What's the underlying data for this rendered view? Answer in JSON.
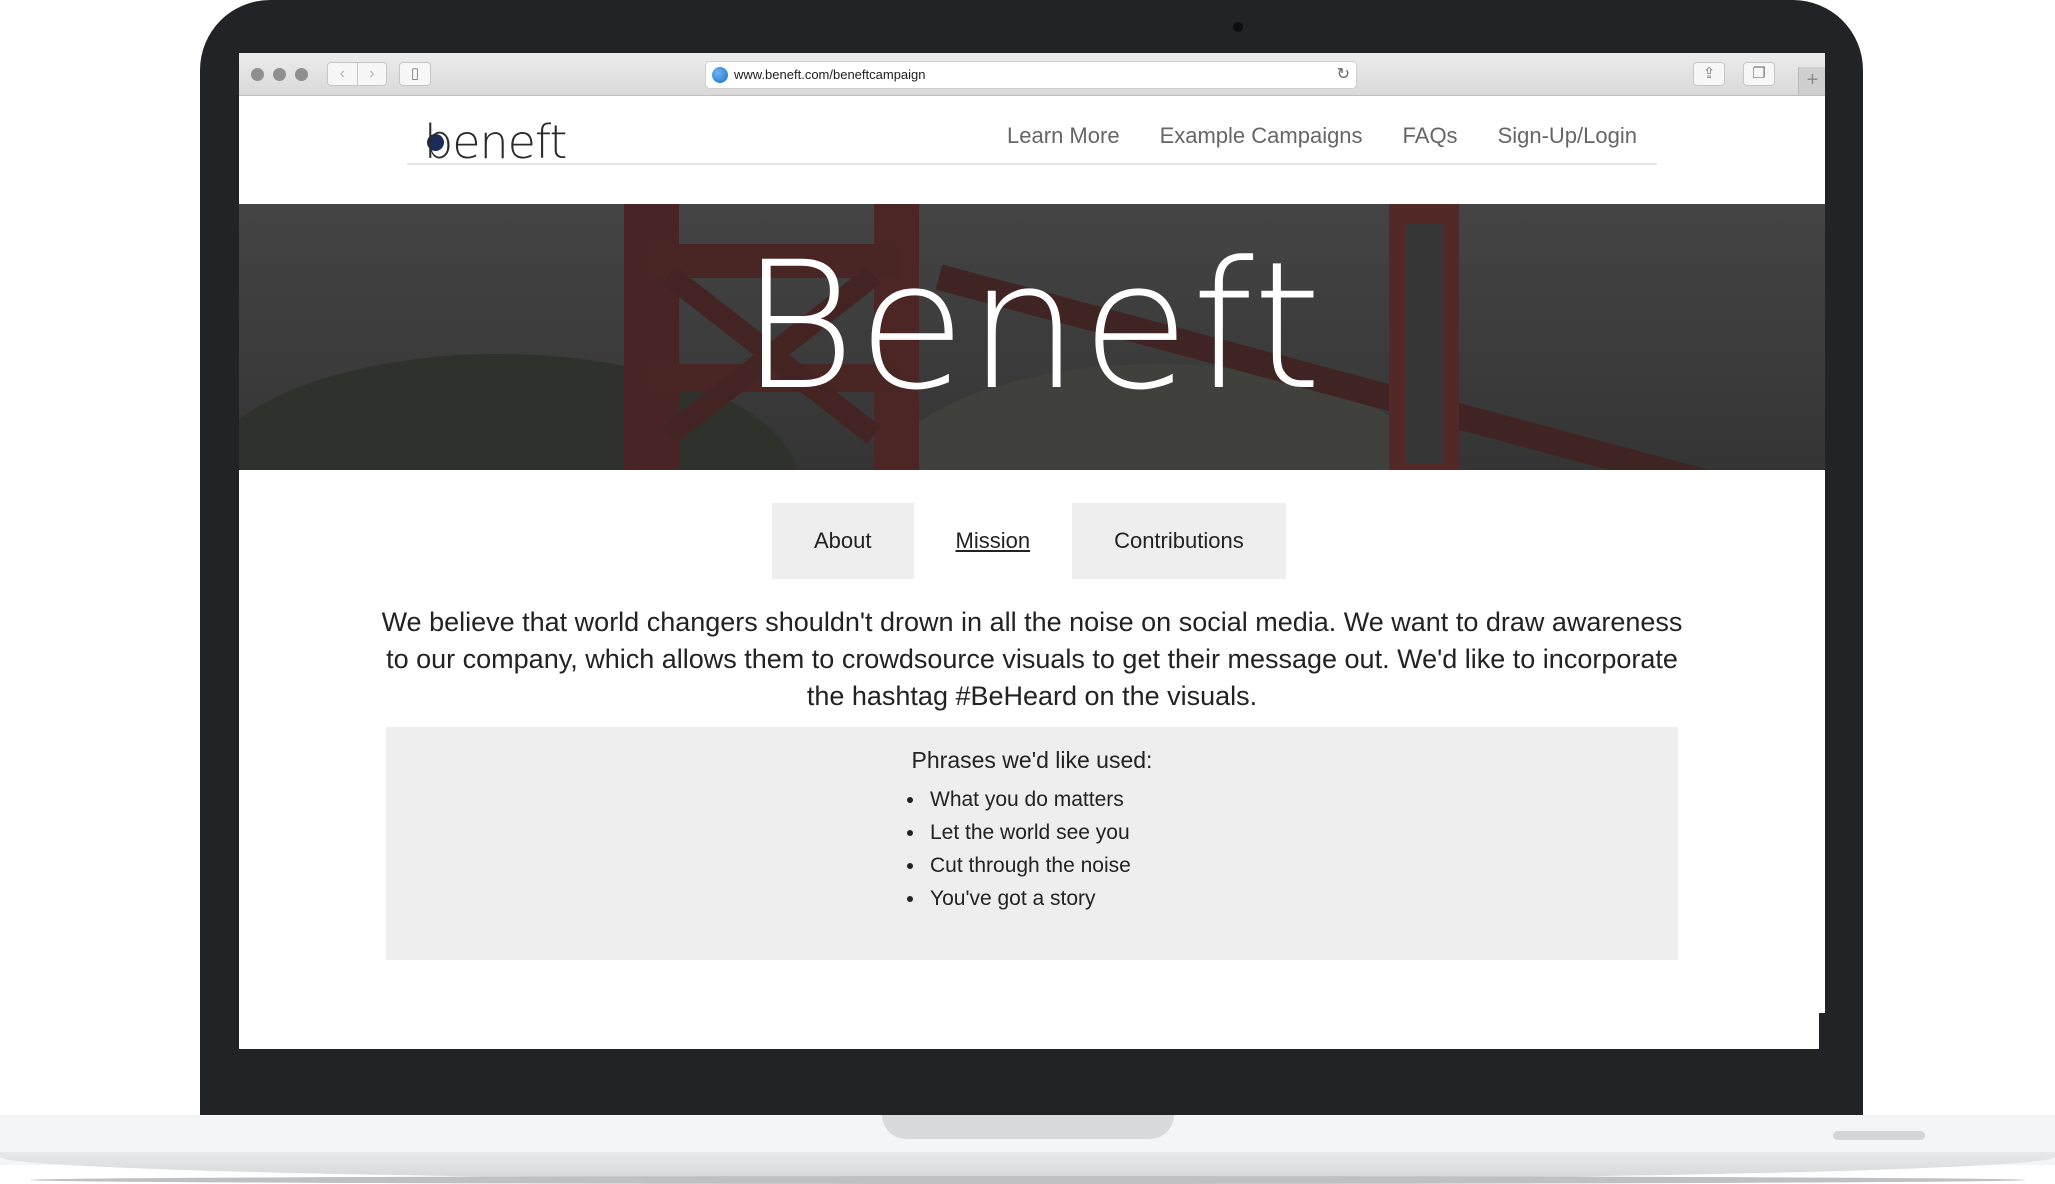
{
  "browser": {
    "url": "www.beneft.com/beneftcampaign"
  },
  "site": {
    "logo_text": "beneft",
    "nav": [
      "Learn More",
      "Example Campaigns",
      "FAQs",
      "Sign-Up/Login"
    ]
  },
  "hero": {
    "title": "Beneft"
  },
  "tabs": [
    {
      "label": "About",
      "active": false
    },
    {
      "label": "Mission",
      "active": true
    },
    {
      "label": "Contributions",
      "active": false
    }
  ],
  "mission_text": "We believe that world changers shouldn't drown in all the noise on social media. We want to draw awareness to our company, which allows them to crowdsource visuals to get their message out. We'd like to incorporate the hashtag #BeHeard on the visuals.",
  "phrases": {
    "title": "Phrases we'd like used:",
    "items": [
      "What you do matters",
      "Let the world see you",
      "Cut through the noise",
      "You've got a story"
    ]
  },
  "colors": {
    "logo_dot": "#1b2c5c",
    "tab_bg": "#eeeeee",
    "laptop_bezel": "#222327"
  }
}
